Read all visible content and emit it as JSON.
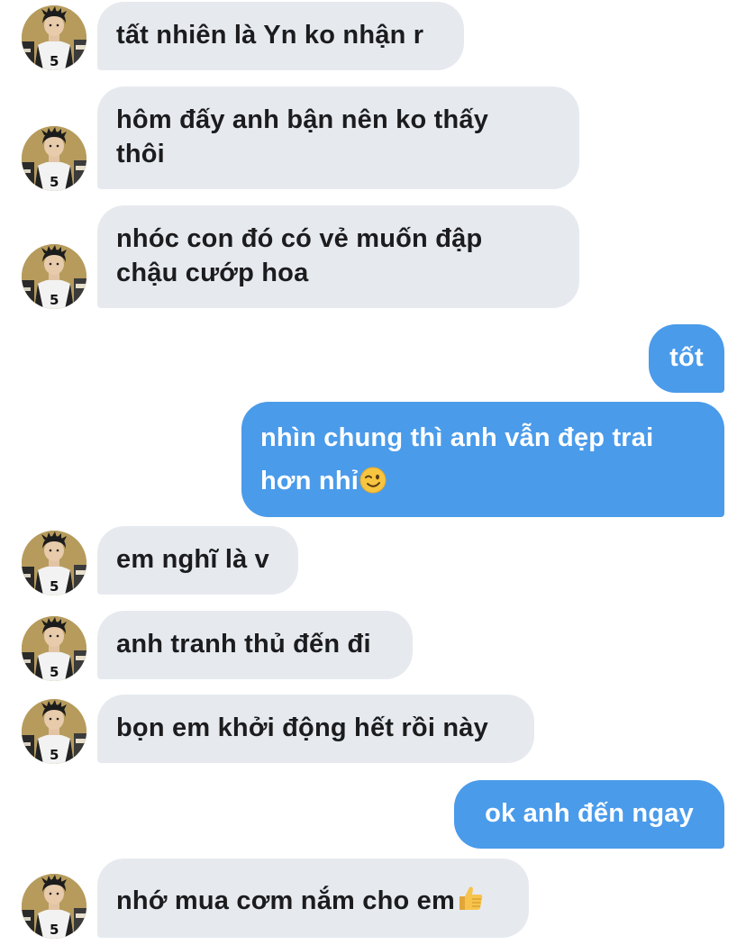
{
  "messages": [
    {
      "side": "in",
      "text": "tất nhiên là Yn ko nhận r"
    },
    {
      "side": "in",
      "line1": "hôm đấy anh bận nên ko thấy",
      "line2": "thôi"
    },
    {
      "side": "in",
      "line1": "nhóc con đó có vẻ muốn đập",
      "line2": "chậu cướp hoa"
    },
    {
      "side": "out",
      "text": "tốt"
    },
    {
      "side": "out",
      "line1": "nhìn chung thì anh vẫn đẹp trai",
      "line2": "hơn nhỉ",
      "emoji": "winking-face-emoji"
    },
    {
      "side": "in",
      "text": "em nghĩ là v"
    },
    {
      "side": "in",
      "text": "anh tranh thủ đến đi"
    },
    {
      "side": "in",
      "text": "bọn em khởi động hết rồi này"
    },
    {
      "side": "out",
      "text": "ok anh đến ngay"
    },
    {
      "side": "in",
      "text": "nhớ mua cơm nắm cho em",
      "emoji": "thumbs-up-emoji"
    }
  ],
  "colors": {
    "incoming_bubble": "#e6eaef",
    "outgoing_bubble": "#4a9bea",
    "incoming_text": "#1c1c1e",
    "outgoing_text": "#ffffff"
  },
  "icons": {
    "avatar": "contact-avatar-image"
  }
}
